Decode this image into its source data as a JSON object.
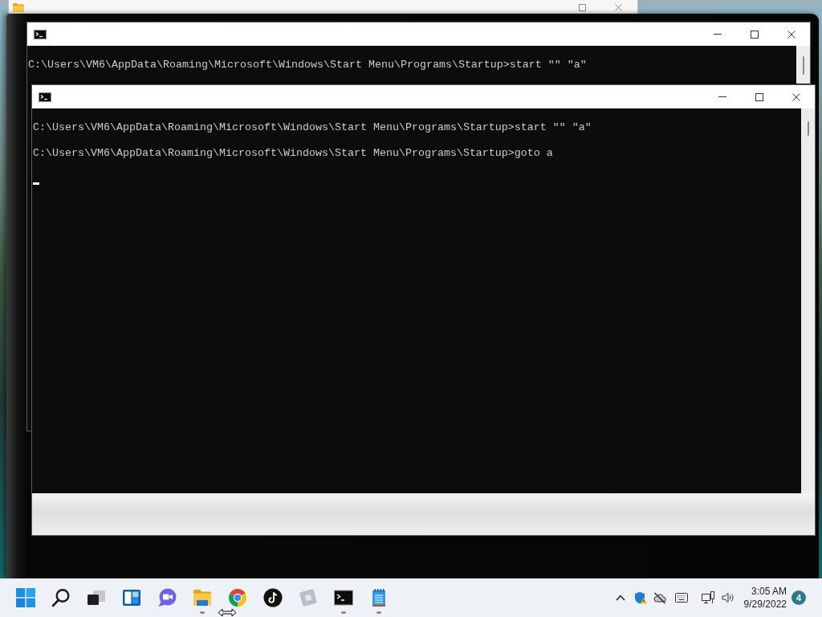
{
  "windows": [
    {
      "lines": [
        "C:\\Users\\VM6\\AppData\\Roaming\\Microsoft\\Windows\\Start Menu\\Programs\\Startup>start \"\" \"a\""
      ],
      "cursor": false
    },
    {
      "lines": [
        "C:\\Users\\VM6\\AppData\\Roaming\\Microsoft\\Windows\\Start Menu\\Programs\\Startup>start \"\" \"a\"",
        "C:\\Users\\VM6\\AppData\\Roaming\\Microsoft\\Windows\\Start Menu\\Programs\\Startup>goto a"
      ],
      "cursor": true
    }
  ],
  "taskbar": {
    "apps": [
      {
        "kind": "start",
        "running": false
      },
      {
        "kind": "search",
        "running": false
      },
      {
        "kind": "task_view",
        "running": false
      },
      {
        "kind": "widgets",
        "running": false
      },
      {
        "kind": "chat",
        "running": false
      },
      {
        "kind": "explorer",
        "running": true
      },
      {
        "kind": "browser",
        "running": false
      },
      {
        "kind": "music",
        "running": false
      },
      {
        "kind": "cube",
        "running": false
      },
      {
        "kind": "terminal",
        "running": true
      },
      {
        "kind": "notepad",
        "running": true
      }
    ],
    "tray": {
      "time": "3:05 AM",
      "date": "9/29/2022",
      "notification_count": "4"
    }
  }
}
